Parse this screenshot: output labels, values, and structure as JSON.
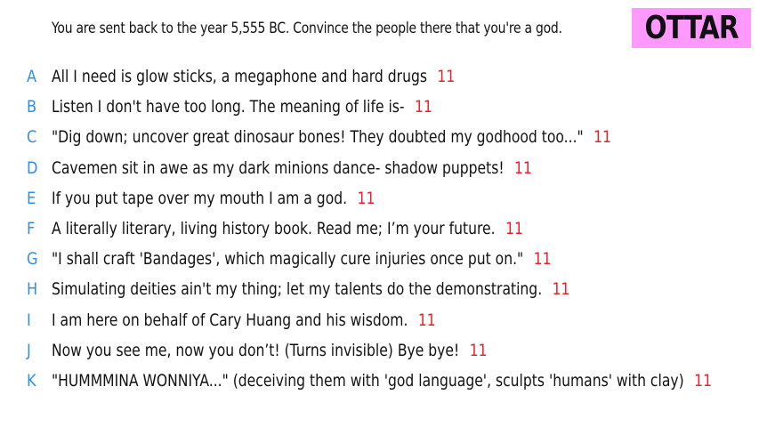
{
  "prompt": "You are sent back to the year 5,555 BC. Convince the people there that you're a god.",
  "badge": "OTTAR",
  "colors": {
    "badge_bg": "#ff99ff",
    "letter": "#2f8fe6",
    "score": "#e8202a"
  },
  "answers": [
    {
      "letter": "A",
      "text": "All I need is glow sticks, a megaphone and hard drugs",
      "score": "11"
    },
    {
      "letter": "B",
      "text": "Listen I don't have too long. The meaning of life is-",
      "score": "11"
    },
    {
      "letter": "C",
      "text": "\"Dig down; uncover great dinosaur bones! They doubted my godhood too...\"",
      "score": "11"
    },
    {
      "letter": "D",
      "text": "Cavemen sit in awe as my dark minions dance- shadow puppets!",
      "score": "11"
    },
    {
      "letter": "E",
      "text": "If you put tape over my mouth I am a god.",
      "score": "11"
    },
    {
      "letter": "F",
      "text": "A literally literary, living history book. Read me; I’m your future.",
      "score": "11"
    },
    {
      "letter": "G",
      "text": "\"I shall craft 'Bandages', which magically cure injuries once put on.\"",
      "score": "11"
    },
    {
      "letter": "H",
      "text": "Simulating deities ain't my thing; let my talents do the demonstrating.",
      "score": "11"
    },
    {
      "letter": "I",
      "text": "I am here on behalf of Cary Huang and his wisdom.",
      "score": "11"
    },
    {
      "letter": "J",
      "text": "Now you see me, now you don’t! (Turns invisible) Bye bye!",
      "score": "11"
    },
    {
      "letter": "K",
      "text": "\"HUMMMINA WONNIYA...\" (deceiving them with 'god language', sculpts 'humans' with clay)",
      "score": "11"
    }
  ]
}
